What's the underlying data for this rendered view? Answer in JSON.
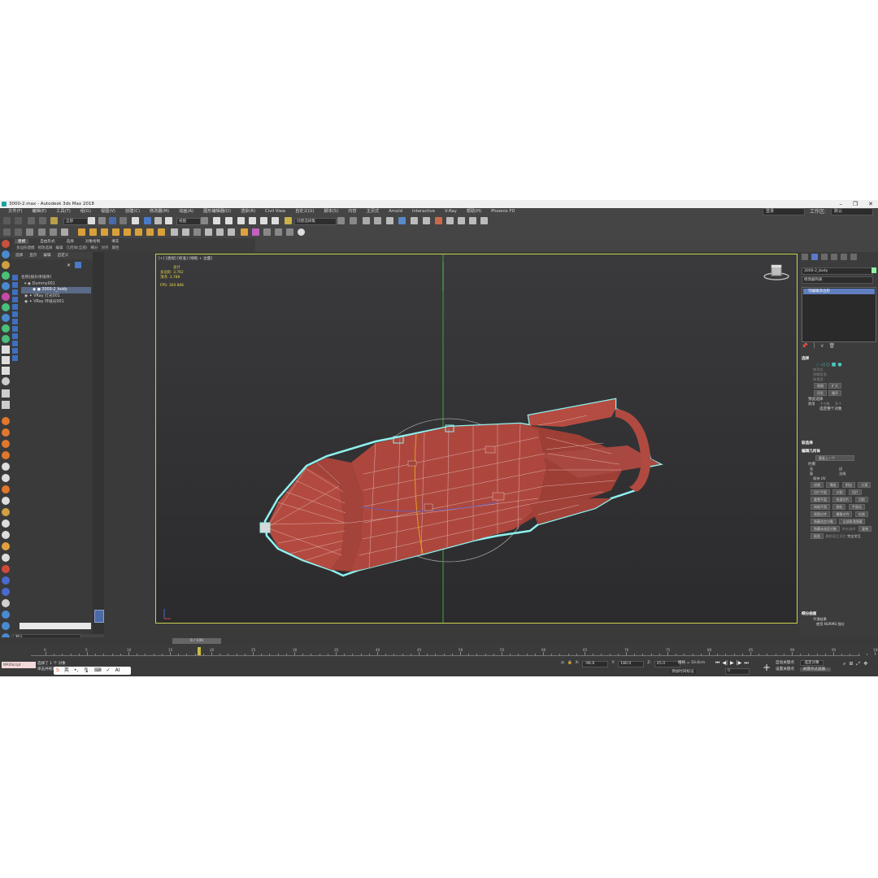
{
  "window": {
    "title": "3000-2.max - Autodesk 3ds Max 2018",
    "min": "–",
    "max": "❐",
    "close": "✕"
  },
  "menu": {
    "items": [
      "文件(F)",
      "编辑(E)",
      "工具(T)",
      "组(G)",
      "视图(V)",
      "创建(C)",
      "修改器(M)",
      "动画(A)",
      "图形编辑器(D)",
      "渲染(R)",
      "Civil View",
      "自定义(U)",
      "脚本(S)",
      "内容",
      "主页式",
      "Arnold",
      "Interactive",
      "V-Ray",
      "帮助(H)",
      "Phoenix FD"
    ],
    "user_label": "登录",
    "workspace_label": "工作区:",
    "workspace_value": "默认"
  },
  "toolbar": {
    "filter_dropdown": "全部",
    "view_dropdown": "视图",
    "selection_set_dropdown": "创建选择集"
  },
  "ribbon": {
    "tabs": [
      "建模",
      "自由形式",
      "选择",
      "对象绘制",
      "填充"
    ],
    "active_tab": "建模",
    "subitems": [
      "多边形建模",
      "修改选择",
      "编辑",
      "几何体(全部)",
      "细分",
      "对齐",
      "属性"
    ]
  },
  "scene_explorer": {
    "header": [
      "选择",
      "显示",
      "编辑",
      "自定义"
    ],
    "column_title": "名称(按升序排序)",
    "items": [
      {
        "name": "Dummy001",
        "selected": false
      },
      {
        "name": "3000-2_body",
        "selected": true
      },
      {
        "name": "VRay 灯光001",
        "selected": false
      },
      {
        "name": "VRay 环境光001",
        "selected": false
      }
    ],
    "layer_label": "默认"
  },
  "viewport": {
    "label": "[+] [透视] [标准] [线框 + 边面]",
    "stats_title": "总计",
    "polys_label": "多边形:",
    "polys_value": "3,762",
    "verts_label": "顶点:",
    "verts_value": "3,788",
    "fps_label": "FPS:",
    "fps_value": "300.886"
  },
  "command_panel": {
    "object_name": "3000-2_body",
    "modifier_list_label": "修改器列表",
    "stack_item": "可编辑多边形",
    "selection_section": "选择",
    "selection_options": [
      "按顶点",
      "忽略背面",
      "按角度:",
      "收缩",
      "扩大",
      "环形",
      "循环"
    ],
    "preview_label": "预览选择",
    "preview_options": [
      "禁用",
      "子对象",
      "多个"
    ],
    "selected_whole": "选定整个对象",
    "soft_selection": "软选择",
    "edit_geometry": "编辑几何体",
    "repeat_last": "重复上一个",
    "constraints_label": "约束",
    "constraints": [
      "无",
      "边",
      "面",
      "法线"
    ],
    "preserve_uv": "保持 UV",
    "geo_buttons": [
      "创建",
      "塌陷",
      "附加",
      "分离",
      "切片平面",
      "分割",
      "切片",
      "重置平面",
      "快速切片",
      "切割",
      "网格平滑",
      "细化",
      "平面化",
      "视图对齐",
      "栅格对齐",
      "松弛",
      "隐藏选定对象",
      "全部取消隐藏",
      "隐藏未选定对象",
      "命名选择:",
      "复制",
      "粘贴",
      "删除孤立顶点",
      "完全交互"
    ],
    "subdivision_surface": "细分曲面",
    "smooth_result": "平滑结果",
    "use_nurms": "使用 NURMS 细分"
  },
  "time": {
    "frame_display": "0 / 100",
    "ticks": [
      "0",
      "5",
      "10",
      "15",
      "20",
      "25",
      "30",
      "35",
      "40",
      "45",
      "50",
      "55",
      "60",
      "65",
      "70",
      "75",
      "80",
      "85",
      "90",
      "95",
      "100"
    ]
  },
  "status": {
    "script_label": "MAXScript",
    "selected": "选择了 1 个 对象",
    "hint": "单击并拖动以选择并移动对象",
    "x_value": "-96.6",
    "y_value": "180.0",
    "z_value": "45.0",
    "grid": "栅格 = 10.0cm",
    "add_time_tag": "添加时间标记",
    "frame_field": "0",
    "auto_key": "自动关键点",
    "set_key": "设置关键点",
    "key_filter": "选定对象",
    "key_filters_btn": "关键点过滤器..."
  },
  "ime": {
    "lang": "英",
    "ai": "AI"
  },
  "colors": {
    "model_fill": "#a8453c",
    "wire": "#e4c3bd",
    "selection_outline": "#8ff1ef",
    "viewport_border": "#c7d24a"
  }
}
